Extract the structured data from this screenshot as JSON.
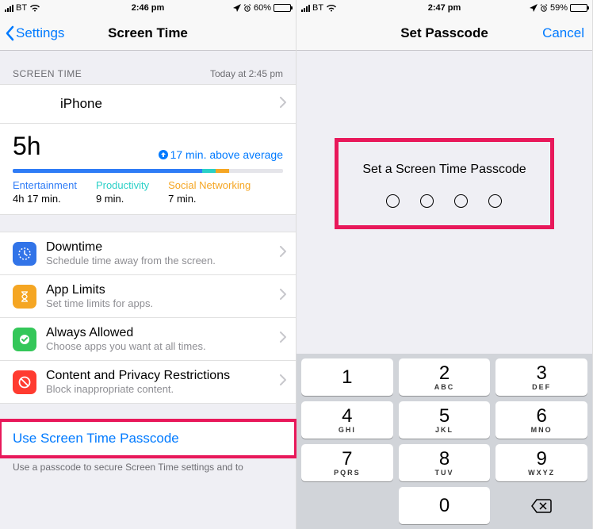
{
  "left": {
    "status": {
      "carrier": "BT",
      "time": "2:46 pm",
      "battery_pct": "60%",
      "battery_fill": 60
    },
    "nav": {
      "back": "Settings",
      "title": "Screen Time"
    },
    "section": {
      "header": "SCREEN TIME",
      "asof": "Today at 2:45 pm"
    },
    "device": "iPhone",
    "usage": {
      "total": "5h",
      "above_avg": "17 min. above average",
      "seg_pct": [
        70,
        5,
        5
      ],
      "categories": [
        {
          "name": "Entertainment",
          "time": "4h 17 min."
        },
        {
          "name": "Productivity",
          "time": "9 min."
        },
        {
          "name": "Social Networking",
          "time": "7 min."
        }
      ]
    },
    "rows": [
      {
        "id": "downtime",
        "title": "Downtime",
        "sub": "Schedule time away from the screen.",
        "color": "#3274e8",
        "icon": "clock-dots"
      },
      {
        "id": "app-limits",
        "title": "App Limits",
        "sub": "Set time limits for apps.",
        "color": "#f5a623",
        "icon": "hourglass"
      },
      {
        "id": "always-allowed",
        "title": "Always Allowed",
        "sub": "Choose apps you want at all times.",
        "color": "#34c759",
        "icon": "check-badge"
      },
      {
        "id": "content-privacy",
        "title": "Content and Privacy Restrictions",
        "sub": "Block inappropriate content.",
        "color": "#ff3b30",
        "icon": "no-entry"
      }
    ],
    "passcode_link": "Use Screen Time Passcode",
    "footnote": "Use a passcode to secure Screen Time settings and to"
  },
  "right": {
    "status": {
      "carrier": "BT",
      "time": "2:47 pm",
      "battery_pct": "59%",
      "battery_fill": 59
    },
    "nav": {
      "title": "Set Passcode",
      "cancel": "Cancel"
    },
    "prompt": "Set a Screen Time Passcode",
    "keys": [
      {
        "d": "1",
        "l": ""
      },
      {
        "d": "2",
        "l": "ABC"
      },
      {
        "d": "3",
        "l": "DEF"
      },
      {
        "d": "4",
        "l": "GHI"
      },
      {
        "d": "5",
        "l": "JKL"
      },
      {
        "d": "6",
        "l": "MNO"
      },
      {
        "d": "7",
        "l": "PQRS"
      },
      {
        "d": "8",
        "l": "TUV"
      },
      {
        "d": "9",
        "l": "WXYZ"
      },
      {
        "d": "",
        "l": ""
      },
      {
        "d": "0",
        "l": ""
      },
      {
        "d": "⌫",
        "l": ""
      }
    ]
  }
}
